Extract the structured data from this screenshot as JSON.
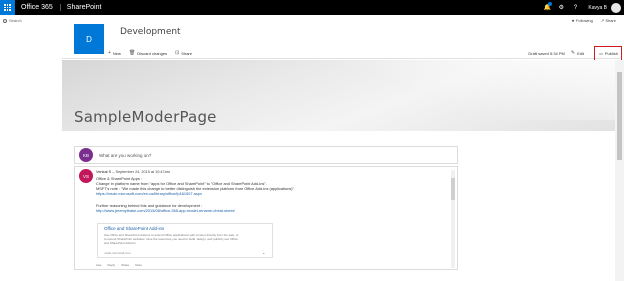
{
  "suite": {
    "brand": "Office 365",
    "app": "SharePoint",
    "user": "Kavya B",
    "icons": [
      "app-launcher-icon",
      "bell-icon",
      "settings-icon",
      "help-icon"
    ]
  },
  "left": {
    "search_placeholder": "Search"
  },
  "site": {
    "logo_letter": "D",
    "title": "Development",
    "following": "Following",
    "share": "Share"
  },
  "commandbar": {
    "new": "New",
    "discard": "Discard changes",
    "share": "Share",
    "draft_status": "Draft saved 5:34 PM",
    "edit": "Edit",
    "publish": "Publish"
  },
  "page": {
    "title": "SampleModerPage"
  },
  "yammer": {
    "compose_avatar": "KB",
    "compose_placeholder": "What are you working on?",
    "post": {
      "avatar": "VS",
      "author": "Venkat S",
      "date": "September 24, 2015 at 10:47am",
      "lines": [
        "Office & SharePoint Apps :",
        "Change in platform name from \"apps for Office and SharePoint\" to \"Office and SharePoint Add-ins\".",
        "MSFT's note : \"We made this change to better distinguish the extension platform from Office Add-ins (applications)\"",
        "https://msdn.microsoft.com/en-us/library/office/fp161507.aspx",
        "",
        "Further reasoning behind this and guidance for development :",
        "http://www.jeremythake.com/2015/08/office-365-app-model-rename-cheat-sheet/"
      ],
      "card": {
        "title": "Office and SharePoint Add-ins",
        "desc": [
          "Use Office and SharePoint Add-ins to extend Office applications with content directly from the web, or",
          "to extend SharePoint websites. Give the resources you need to build, design, and publish your Office",
          "and SharePoint Add-ins.",
          "msdn.microsoft.com"
        ]
      },
      "actions": [
        "Like",
        "Reply",
        "Share",
        "More"
      ]
    }
  }
}
